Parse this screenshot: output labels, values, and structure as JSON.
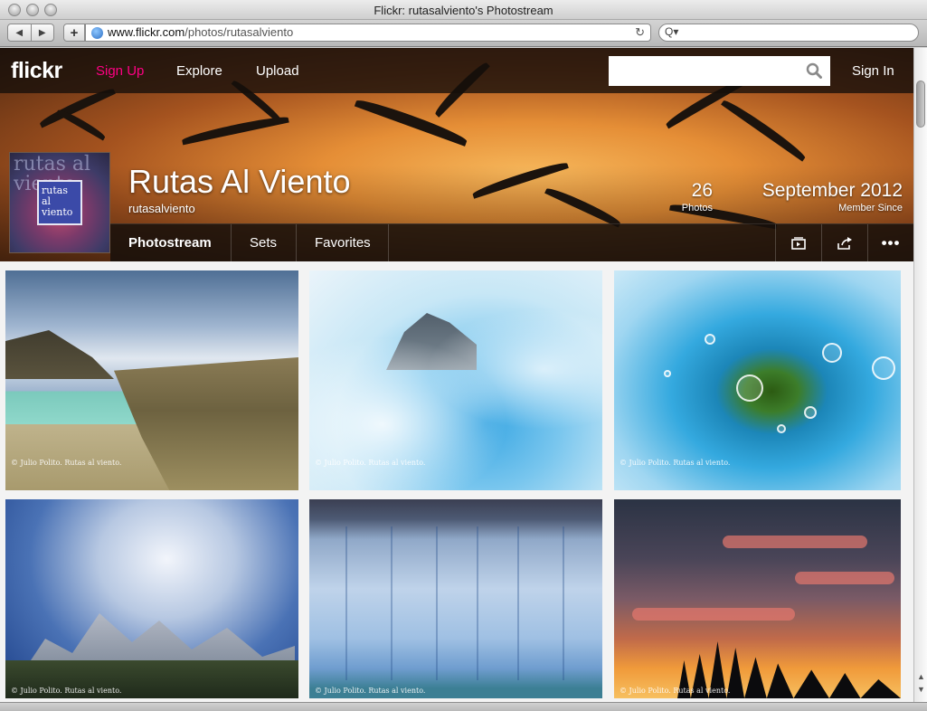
{
  "window": {
    "title": "Flickr: rutasalviento's Photostream"
  },
  "browser": {
    "url_host": "www.flickr.com",
    "url_path": "/photos/rutasalviento",
    "back_label": "◀",
    "forward_label": "▶",
    "add_label": "+",
    "reload_label": "↻",
    "search_icon_label": "Q▾"
  },
  "nav": {
    "logo": "flickr",
    "signup": "Sign Up",
    "explore": "Explore",
    "upload": "Upload",
    "search_placeholder": "",
    "signin": "Sign In"
  },
  "profile": {
    "avatar_bg_text": "rutas al viento",
    "avatar_logo_text": "rutas al viento",
    "name": "Rutas Al Viento",
    "username": "rutasalviento",
    "photos_count": "26",
    "photos_label": "Photos",
    "member_since": "September 2012",
    "member_since_label": "Member Since"
  },
  "tabs": [
    {
      "label": "Photostream"
    },
    {
      "label": "Sets"
    },
    {
      "label": "Favorites"
    }
  ],
  "actions": {
    "slideshow_icon": "slideshow-icon",
    "share_icon": "share-icon",
    "more_label": "•••"
  },
  "photos": {
    "credit": "© Julio Polito. Rutas al viento."
  },
  "colors": {
    "flickr_pink": "#ff0084",
    "nav_bg": "#1a120c"
  }
}
